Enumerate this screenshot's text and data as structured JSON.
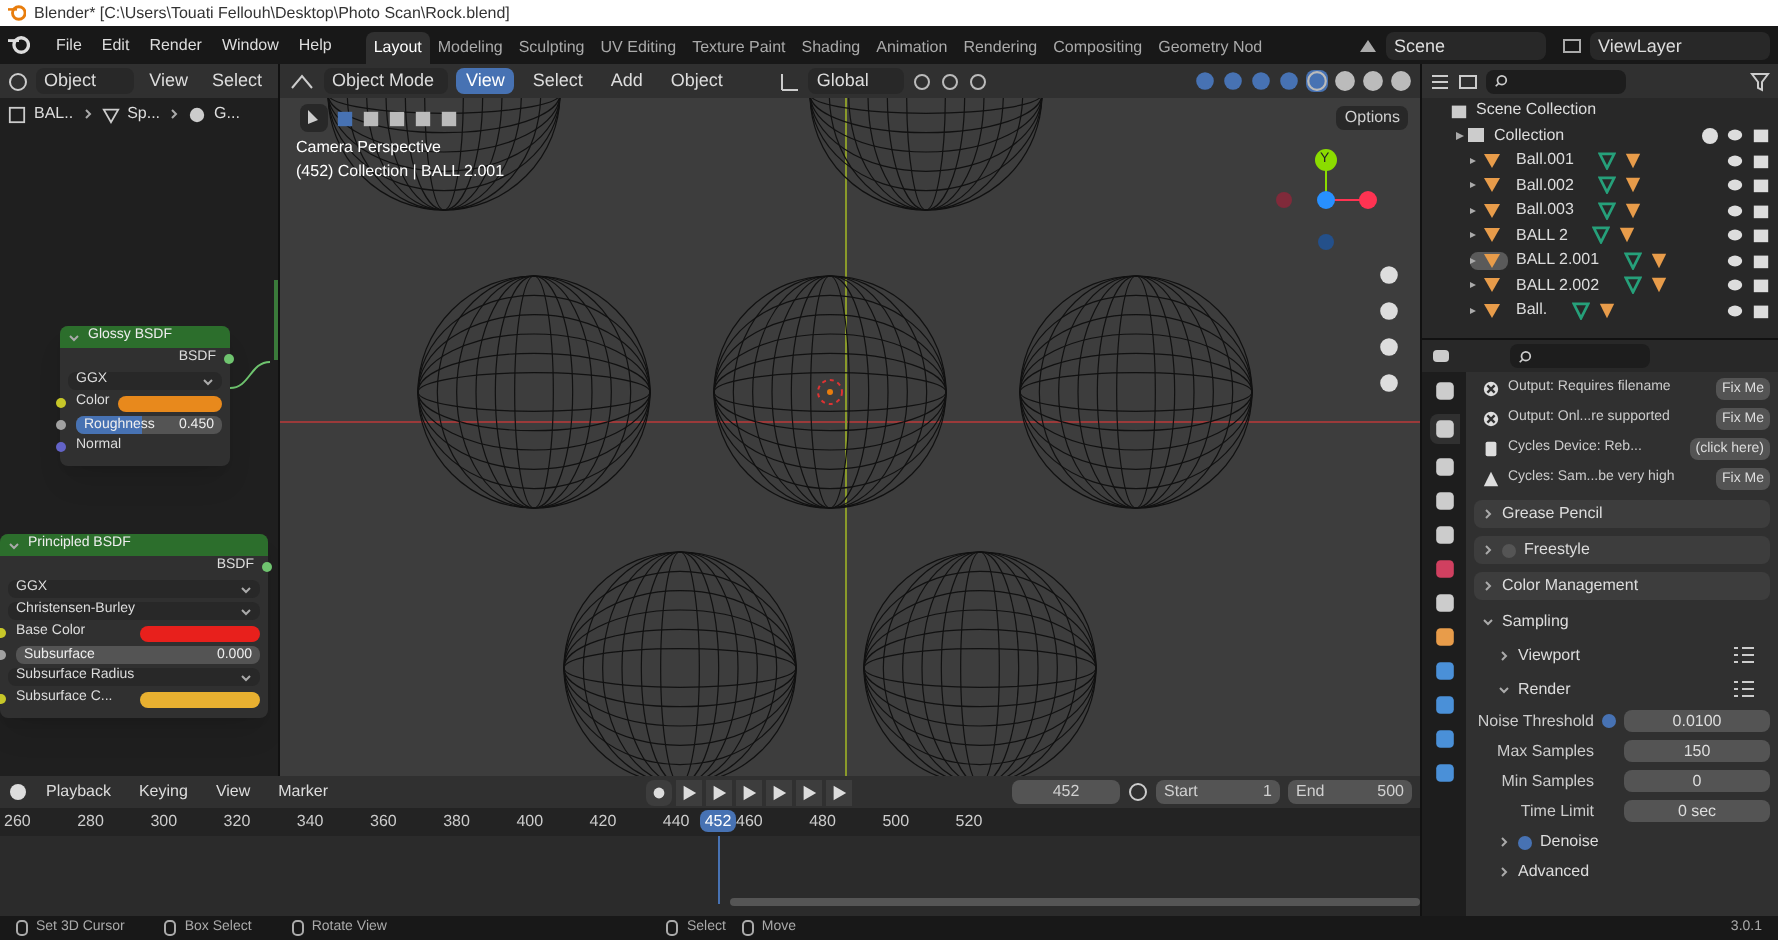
{
  "window": {
    "title": "Blender* [C:\\Users\\Touati Fellouh\\Desktop\\Photo Scan\\Rock.blend]"
  },
  "menu": [
    "File",
    "Edit",
    "Render",
    "Window",
    "Help"
  ],
  "workspaces": [
    {
      "label": "Layout",
      "selected": true
    },
    {
      "label": "Modeling",
      "selected": false
    },
    {
      "label": "Sculpting",
      "selected": false
    },
    {
      "label": "UV Editing",
      "selected": false
    },
    {
      "label": "Texture Paint",
      "selected": false
    },
    {
      "label": "Shading",
      "selected": false
    },
    {
      "label": "Animation",
      "selected": false
    },
    {
      "label": "Rendering",
      "selected": false
    },
    {
      "label": "Compositing",
      "selected": false
    },
    {
      "label": "Geometry Nod",
      "selected": false
    }
  ],
  "scene": "Scene",
  "view_layer": "ViewLayer",
  "node_editor": {
    "mode": "Object",
    "menus": [
      "View",
      "Select"
    ],
    "breadcrumb": [
      "BAL..",
      "Sp...",
      "G..."
    ],
    "nodes": [
      {
        "title": "Glossy BSDF",
        "output": "BSDF",
        "rows": [
          {
            "kind": "dropdown",
            "label": "GGX"
          },
          {
            "kind": "color",
            "label": "Color",
            "color": "#e8891c"
          },
          {
            "kind": "slider",
            "label": "Roughness",
            "value": "0.450",
            "level": 0.45
          },
          {
            "kind": "socket",
            "label": "Normal"
          }
        ]
      },
      {
        "title": "Principled BSDF",
        "output": "BSDF",
        "rows": [
          {
            "kind": "dropdown",
            "label": "GGX"
          },
          {
            "kind": "dropdown",
            "label": "Christensen-Burley"
          },
          {
            "kind": "color",
            "label": "Base Color",
            "color": "#e8201c"
          },
          {
            "kind": "slider",
            "label": "Subsurface",
            "value": "0.000",
            "level": 0
          },
          {
            "kind": "dropdown",
            "label": "Subsurface Radius"
          },
          {
            "kind": "color",
            "label": "Subsurface C...",
            "color": "#e8b030"
          }
        ]
      }
    ]
  },
  "viewport": {
    "mode": "Object Mode",
    "menus": [
      {
        "label": "View",
        "selected": true
      },
      {
        "label": "Select",
        "selected": false
      },
      {
        "label": "Add",
        "selected": false
      },
      {
        "label": "Object",
        "selected": false
      }
    ],
    "orientation": "Global",
    "overlay": [
      "Camera Perspective",
      "(452) Collection | BALL 2.001"
    ],
    "options": "Options",
    "gizmo_axis": "Y"
  },
  "outliner": {
    "root": "Scene Collection",
    "collections": [
      {
        "label": "Collection",
        "checked": true,
        "children": [
          {
            "label": "Ball.001",
            "selected": false
          },
          {
            "label": "Ball.002",
            "selected": false
          },
          {
            "label": "Ball.003",
            "selected": false
          },
          {
            "label": "BALL 2",
            "selected": false
          },
          {
            "label": "BALL 2.001",
            "selected": true
          },
          {
            "label": "BALL 2.002",
            "selected": false
          },
          {
            "label": "Ball.",
            "selected": false
          }
        ]
      }
    ]
  },
  "properties": {
    "warnings": [
      {
        "kind": "error",
        "text": "Output: Requires filename",
        "button": "Fix Me"
      },
      {
        "kind": "error",
        "text": "Output: Onl...re supported",
        "button": "Fix Me"
      },
      {
        "kind": "info",
        "text": "Cycles Device: Reb...",
        "button": "(click here)"
      },
      {
        "kind": "warning",
        "text": "Cycles: Sam...be very high",
        "button": "Fix Me"
      }
    ],
    "panels": [
      {
        "label": "Grease Pencil"
      },
      {
        "label": "Freestyle",
        "checkbox": false
      },
      {
        "label": "Color Management"
      }
    ],
    "sampling": {
      "label": "Sampling",
      "expanded": true,
      "subpanels": [
        {
          "label": "Viewport",
          "expanded": false
        },
        {
          "label": "Render",
          "expanded": true
        }
      ],
      "fields": [
        {
          "label": "Noise Threshold",
          "value": "0.0100",
          "checked": true
        },
        {
          "label": "Max Samples",
          "value": "150"
        },
        {
          "label": "Min Samples",
          "value": "0"
        },
        {
          "label": "Time Limit",
          "value": "0 sec"
        }
      ],
      "denoise": {
        "label": "Denoise",
        "checked": true
      },
      "advanced": "Advanced"
    }
  },
  "timeline": {
    "menus": [
      "Playback",
      "Keying",
      "View",
      "Marker"
    ],
    "current_frame": "452",
    "start_label": "Start",
    "start": "1",
    "end_label": "End",
    "end": "500",
    "ticks": [
      {
        "label": "260"
      },
      {
        "label": "280"
      },
      {
        "label": "300"
      },
      {
        "label": "320"
      },
      {
        "label": "340"
      },
      {
        "label": "360"
      },
      {
        "label": "380"
      },
      {
        "label": "400"
      },
      {
        "label": "420"
      },
      {
        "label": "440"
      },
      {
        "label": "452",
        "kind": "playhead"
      },
      {
        "label": "460"
      },
      {
        "label": "480"
      },
      {
        "label": "500"
      },
      {
        "label": "520"
      }
    ]
  },
  "status_bar": {
    "items": [
      "Set 3D Cursor",
      "Box Select",
      "Rotate View",
      "Select",
      "Move"
    ],
    "version": "3.0.1"
  }
}
